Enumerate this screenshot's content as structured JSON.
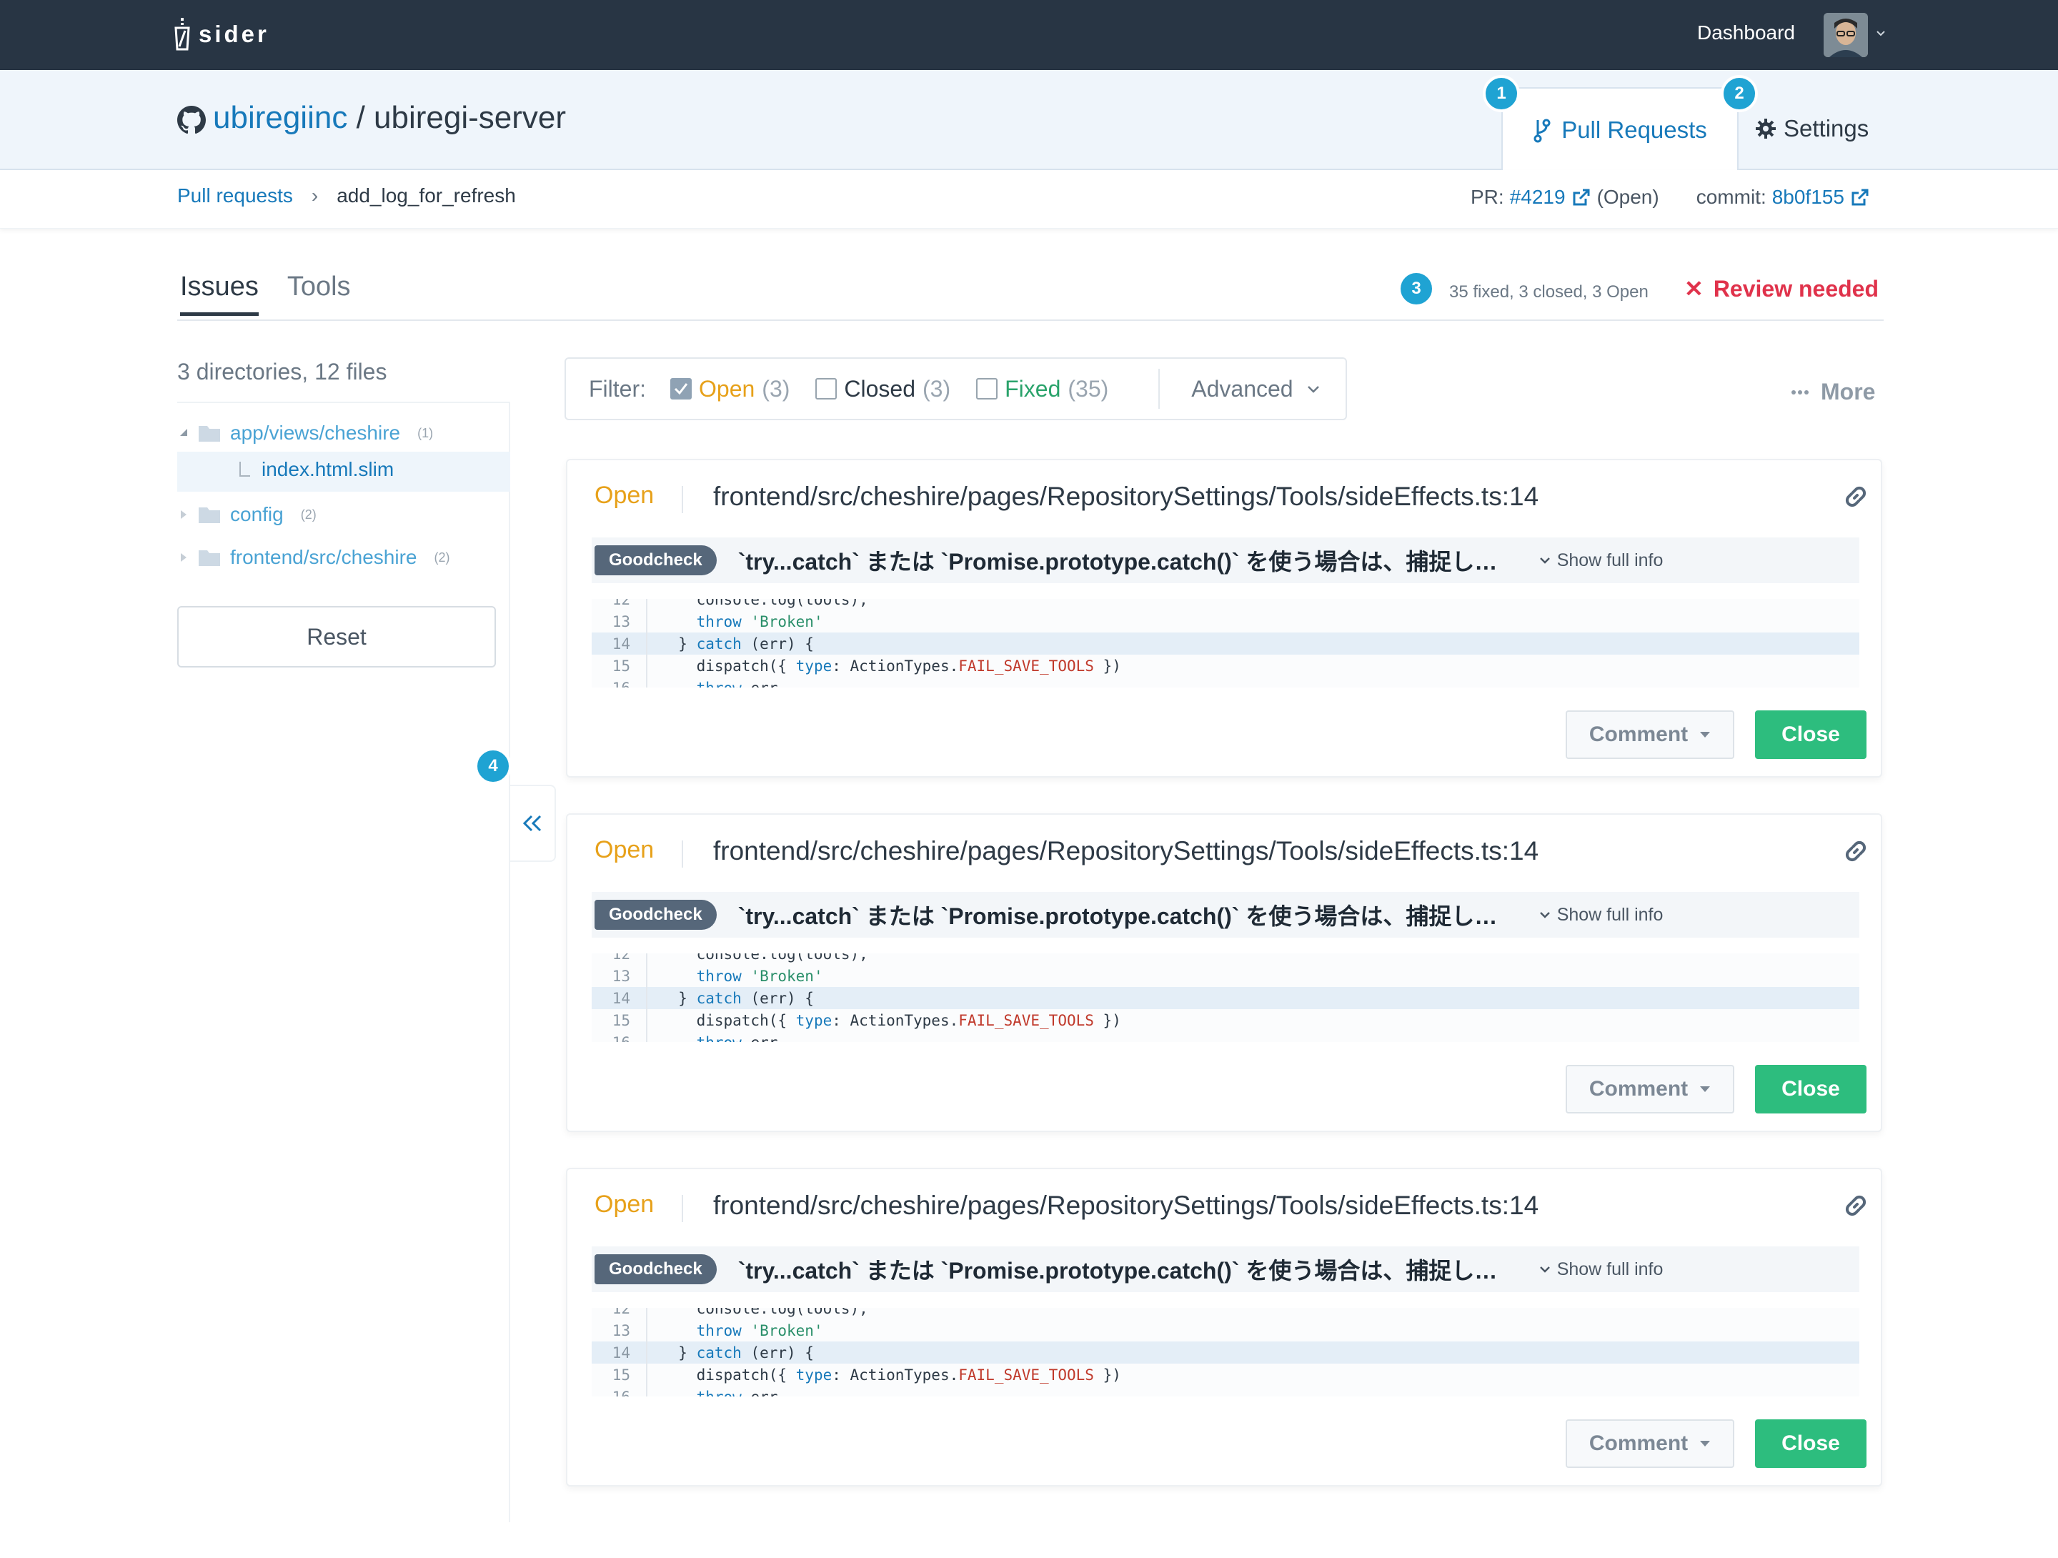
{
  "app": {
    "logo_text": "sider",
    "nav_dashboard": "Dashboard"
  },
  "repo": {
    "owner": "ubiregiinc",
    "separator": " / ",
    "name": "ubiregi-server"
  },
  "tabs": {
    "pull_requests": "Pull Requests",
    "settings": "Settings"
  },
  "badges": [
    "1",
    "2",
    "3",
    "4"
  ],
  "breadcrumb": {
    "root": "Pull requests",
    "separator": "›",
    "current": "add_log_for_refresh"
  },
  "pr": {
    "label": "PR:",
    "number": "#4219",
    "state": "(Open)",
    "commit_label": "commit:",
    "commit": "8b0f155"
  },
  "subtabs": {
    "issues": "Issues",
    "tools": "Tools"
  },
  "summary": "35 fixed, 3 closed, 3 Open",
  "review": {
    "icon": "✕",
    "text": "Review needed",
    "color": "#e0324b"
  },
  "sidebar": {
    "count": "3 directories, 12 files",
    "tree": [
      {
        "name": "app/views/cheshire",
        "count": "(1)",
        "expanded": true,
        "children": [
          {
            "name": "index.html.slim"
          }
        ]
      },
      {
        "name": "config",
        "count": "(2)",
        "expanded": false
      },
      {
        "name": "frontend/src/cheshire",
        "count": "(2)",
        "expanded": false
      }
    ],
    "reset": "Reset"
  },
  "filter": {
    "label": "Filter:",
    "options": [
      {
        "name": "Open",
        "count": "(3)",
        "checked": true,
        "color": "#e7a11a"
      },
      {
        "name": "Closed",
        "count": "(3)",
        "checked": false,
        "color": "#2e3a46"
      },
      {
        "name": "Fixed",
        "count": "(35)",
        "checked": false,
        "color": "#2aa36b"
      }
    ],
    "advanced": "Advanced",
    "more": "More"
  },
  "issues": [
    {
      "status": "Open",
      "path": "frontend/src/cheshire/pages/RepositorySettings/Tools/sideEffects.ts:14",
      "tool": "Goodcheck",
      "message": "`try...catch` または `Promise.prototype.catch()` を使う場合は、捕捉した例外を再スローすること...",
      "show_full": "Show full info",
      "comment": "Comment",
      "close": "Close"
    },
    {
      "status": "Open",
      "path": "frontend/src/cheshire/pages/RepositorySettings/Tools/sideEffects.ts:14",
      "tool": "Goodcheck",
      "message": "`try...catch` または `Promise.prototype.catch()` を使う場合は、捕捉した例外を再スローすること...",
      "show_full": "Show full info",
      "comment": "Comment",
      "close": "Close"
    },
    {
      "status": "Open",
      "path": "frontend/src/cheshire/pages/RepositorySettings/Tools/sideEffects.ts:14",
      "tool": "Goodcheck",
      "message": "`try...catch` または `Promise.prototype.catch()` を使う場合は、捕捉した例外を再スローすること...",
      "show_full": "Show full info",
      "comment": "Comment",
      "close": "Close"
    }
  ],
  "code": {
    "lines": [
      {
        "num": "12",
        "text": "    console.log(tools);"
      },
      {
        "num": "13",
        "text": "    throw 'Broken'"
      },
      {
        "num": "14",
        "text": "  } catch (err) {",
        "highlight": true
      },
      {
        "num": "15",
        "text": "    dispatch({ type: ActionTypes.FAIL_SAVE_TOOLS })"
      },
      {
        "num": "16",
        "text": "    throw err"
      }
    ]
  }
}
